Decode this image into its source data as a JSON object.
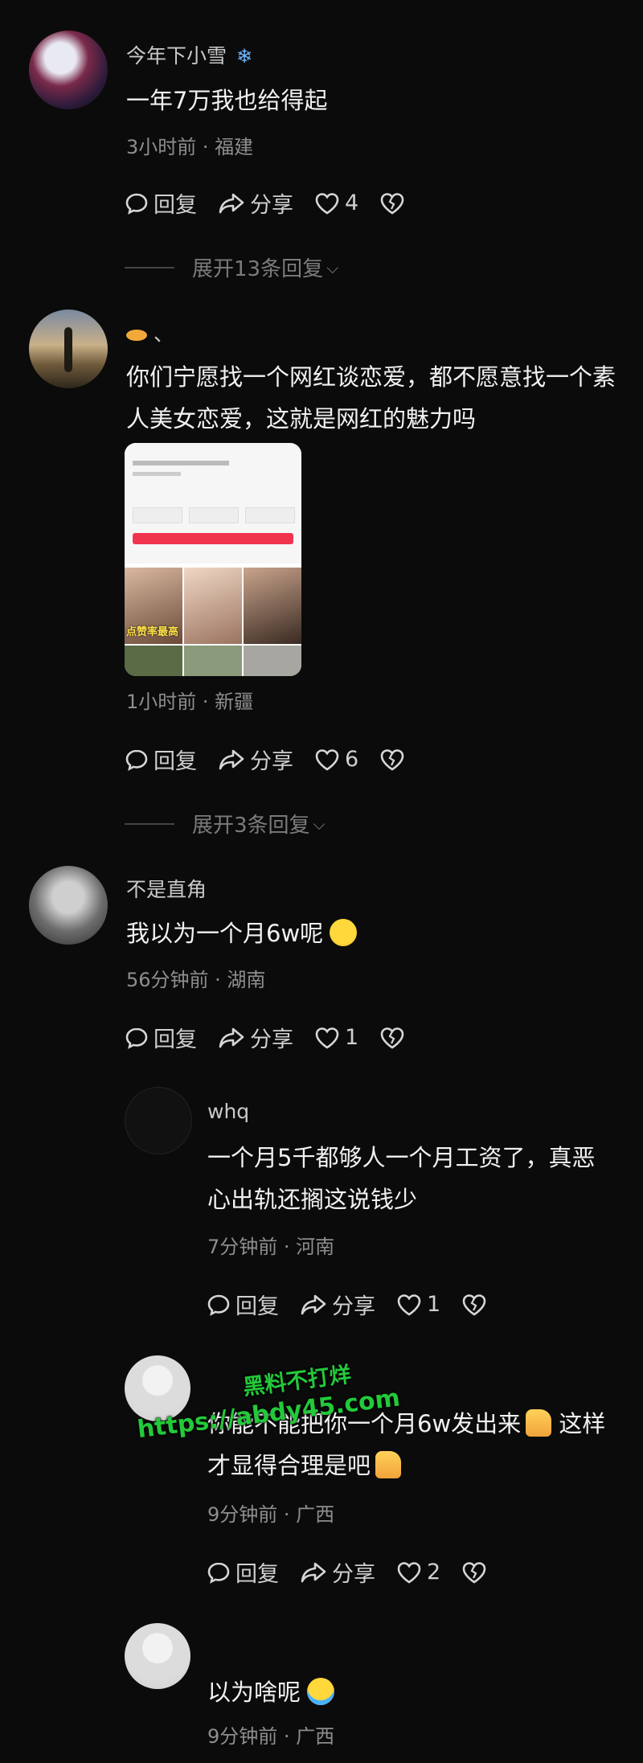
{
  "comments": [
    {
      "name": "今年下小雪",
      "text": "一年7万我也给得起",
      "meta": "3小时前 · 福建",
      "reply_label": "回复",
      "share_label": "分享",
      "likes": "4",
      "expand": "展开13条回复"
    },
    {
      "name": "、",
      "text": "你们宁愿找一个网红谈恋爱，都不愿意找一个素人美女恋爱，这就是网红的魅力吗",
      "meta": "1小时前 · 新疆",
      "reply_label": "回复",
      "share_label": "分享",
      "likes": "6",
      "expand": "展开3条回复",
      "image_caption": "点赞率最高"
    },
    {
      "name": "不是直角",
      "text": "我以为一个月6w呢",
      "meta": "56分钟前 · 湖南",
      "reply_label": "回复",
      "share_label": "分享",
      "likes": "1"
    }
  ],
  "replies": [
    {
      "name": "whq",
      "text": "一个月5千都够人一个月工资了，真恶心出轨还搁这说钱少",
      "meta": "7分钟前 · 河南",
      "reply_label": "回复",
      "share_label": "分享",
      "likes": "1"
    },
    {
      "name": "",
      "text": "你能不能把你一个月6w发出来",
      "text2": "这样才显得合理是吧",
      "meta": "9分钟前 · 广西",
      "reply_label": "回复",
      "share_label": "分享",
      "likes": "2"
    },
    {
      "name": "",
      "text": "以为啥呢",
      "meta": "9分钟前 · 广西"
    }
  ],
  "watermark": {
    "line1": "黑料不打烊",
    "line2": "https://abdy45.com"
  },
  "colors": {
    "background": "#0b0b0b",
    "watermark": "#23c93a"
  }
}
